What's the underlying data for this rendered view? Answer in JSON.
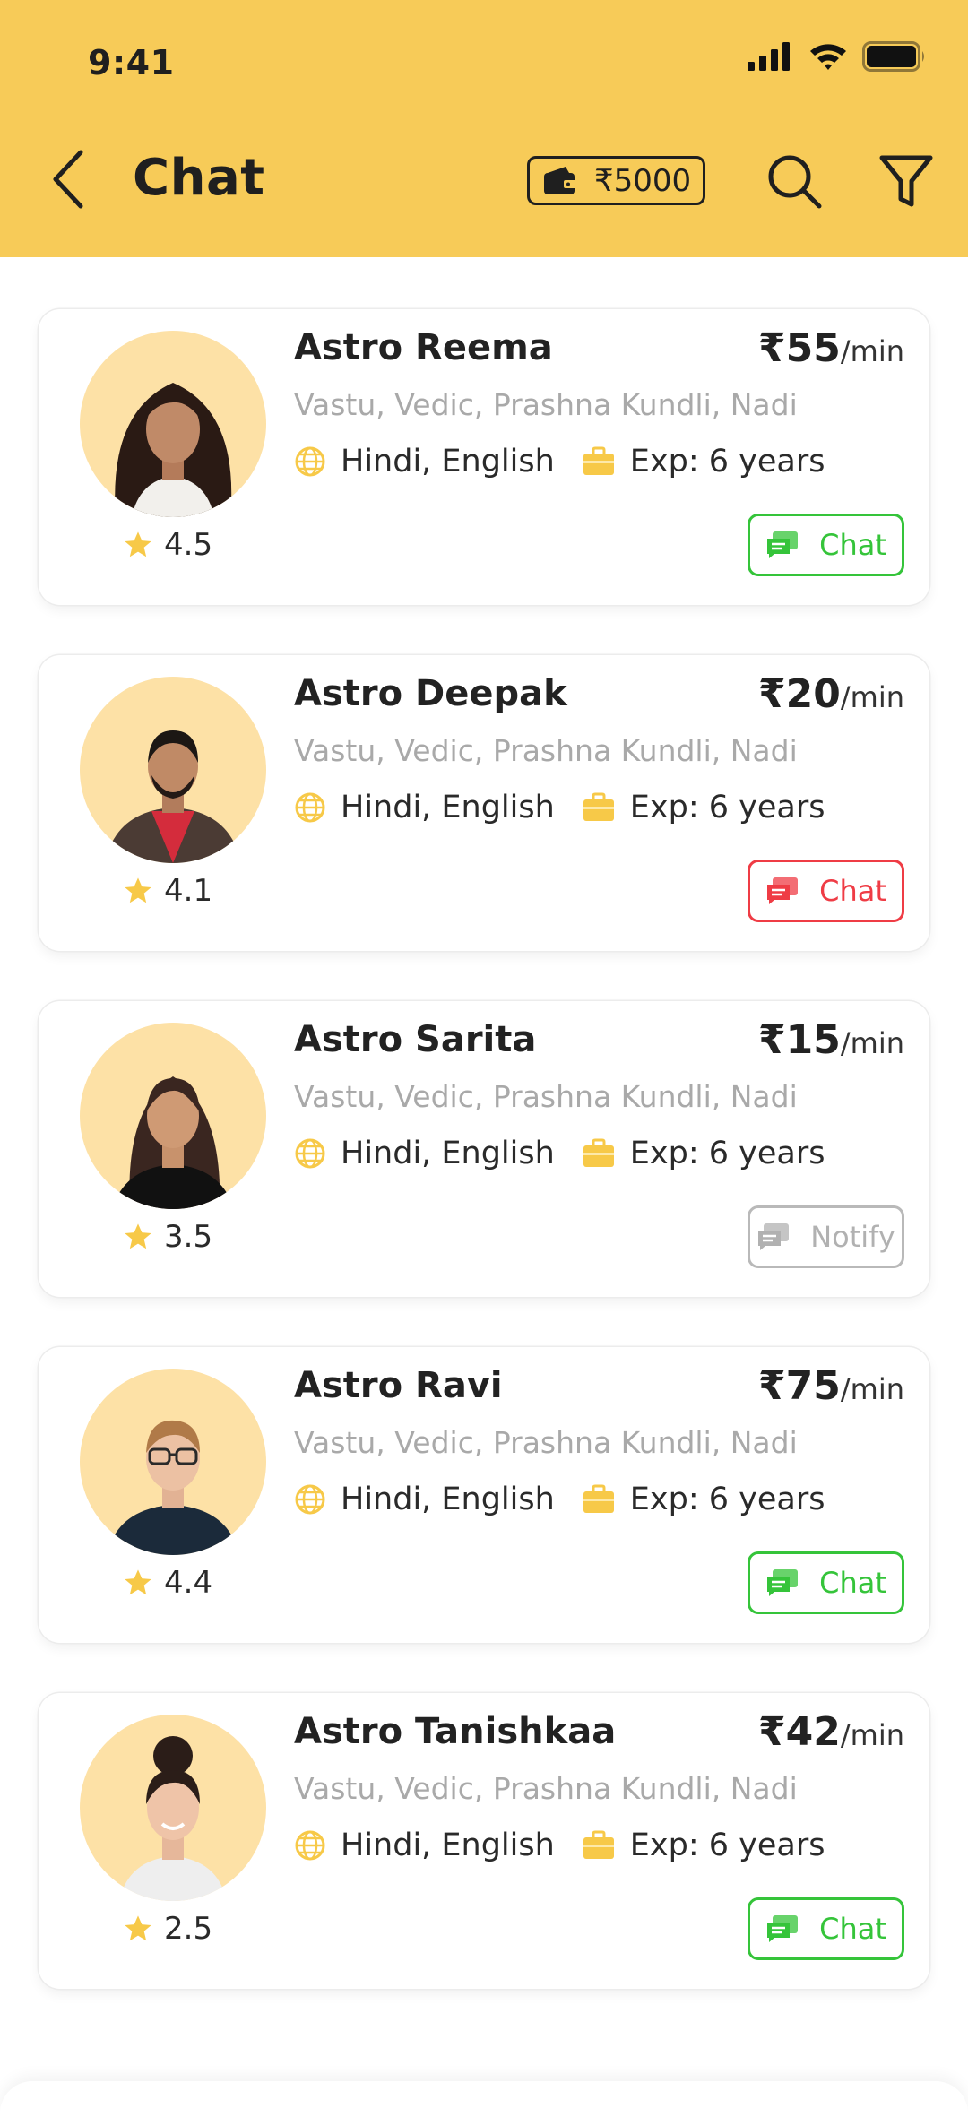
{
  "status_bar": {
    "time": "9:41"
  },
  "header": {
    "title": "Chat",
    "wallet_balance": "₹5000"
  },
  "colors": {
    "header_bg": "#f7cb58",
    "available": "#35c43a",
    "busy": "#ef3c45",
    "offline": "#b1b1b1",
    "star": "#f7c948"
  },
  "astrologers": [
    {
      "name": "Astro Reema",
      "price": "₹55",
      "price_unit": "/min",
      "skills": "Vastu, Vedic, Prashna Kundli, Nadi",
      "languages": "Hindi, English",
      "experience": "Exp: 6 years",
      "rating": "4.5",
      "action_label": "Chat",
      "status": "available"
    },
    {
      "name": "Astro Deepak",
      "price": "₹20",
      "price_unit": "/min",
      "skills": "Vastu, Vedic, Prashna Kundli, Nadi",
      "languages": "Hindi, English",
      "experience": "Exp: 6 years",
      "rating": "4.1",
      "action_label": "Chat",
      "status": "busy"
    },
    {
      "name": "Astro Sarita",
      "price": "₹15",
      "price_unit": "/min",
      "skills": "Vastu, Vedic, Prashna Kundli, Nadi",
      "languages": "Hindi, English",
      "experience": "Exp: 6 years",
      "rating": "3.5",
      "action_label": "Notify",
      "status": "offline"
    },
    {
      "name": "Astro Ravi",
      "price": "₹75",
      "price_unit": "/min",
      "skills": "Vastu, Vedic, Prashna Kundli, Nadi",
      "languages": "Hindi, English",
      "experience": "Exp: 6 years",
      "rating": "4.4",
      "action_label": "Chat",
      "status": "available"
    },
    {
      "name": "Astro Tanishkaa",
      "price": "₹42",
      "price_unit": "/min",
      "skills": "Vastu, Vedic, Prashna Kundli, Nadi",
      "languages": "Hindi, English",
      "experience": "Exp: 6 years",
      "rating": "2.5",
      "action_label": "Chat",
      "status": "available"
    }
  ]
}
